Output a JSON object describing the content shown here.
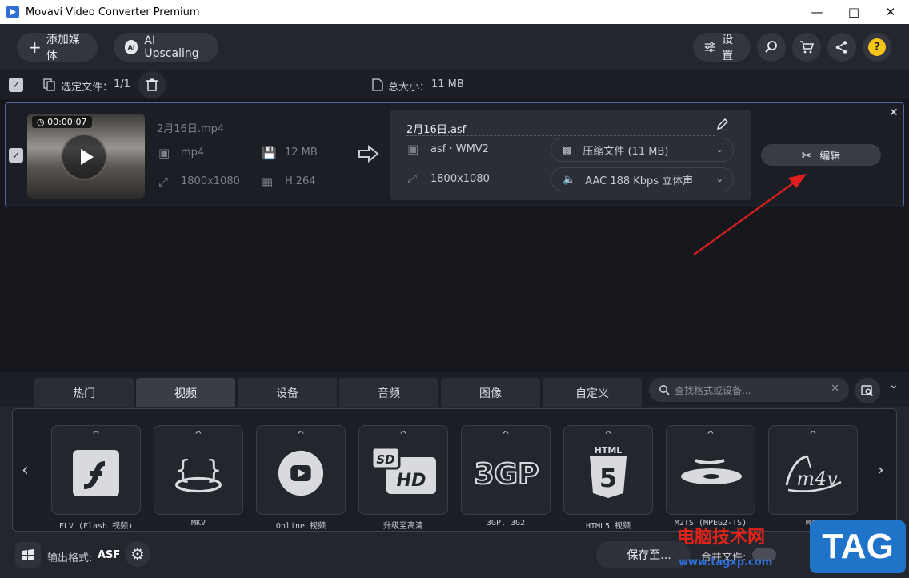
{
  "window": {
    "title": "Movavi Video Converter Premium"
  },
  "toolbar": {
    "add_media": "添加媒体",
    "ai_upscaling": "AI Upscaling",
    "settings": "设置"
  },
  "infobar": {
    "selected_label": "选定文件：",
    "selected_value": "1/1",
    "total_size_label": "总大小：",
    "total_size_value": "11 MB"
  },
  "file": {
    "duration": "00:00:07",
    "name": "2月16日.mp4",
    "format": "mp4",
    "size": "12 MB",
    "resolution": "1800x1080",
    "codec": "H.264"
  },
  "output": {
    "name": "2月16日.asf",
    "format": "asf · WMV2",
    "resolution": "1800x1080",
    "compress": "压缩文件 (11 MB)",
    "audio": "AAC 188 Kbps 立体声"
  },
  "edit_label": "编辑",
  "tabs": [
    "热门",
    "视频",
    "设备",
    "音频",
    "图像",
    "自定义"
  ],
  "active_tab": "视频",
  "search": {
    "placeholder": "查找格式或设备..."
  },
  "formats": [
    {
      "label": "FLV (Flash 视频)",
      "icon": "flash-icon"
    },
    {
      "label": "MKV",
      "icon": "mkv-icon"
    },
    {
      "label": "Online 视频",
      "icon": "youtube-icon"
    },
    {
      "label": "升级至高清",
      "icon": "sd-hd-icon"
    },
    {
      "label": "3GP, 3G2",
      "icon": "3gp-icon"
    },
    {
      "label": "HTML5 视频",
      "icon": "html5-icon"
    },
    {
      "label": "M2TS (MPEG2-TS)",
      "icon": "bluray-icon"
    },
    {
      "label": "M4V",
      "icon": "m4v-icon"
    }
  ],
  "footer": {
    "output_format_label": "输出格式:",
    "output_format_value": "ASF",
    "save_to": "保存至...",
    "merge_files": "合并文件:"
  },
  "watermark": {
    "line1": "电脑技术网",
    "line2": "www.tagxp.com",
    "tag": "TAG"
  }
}
